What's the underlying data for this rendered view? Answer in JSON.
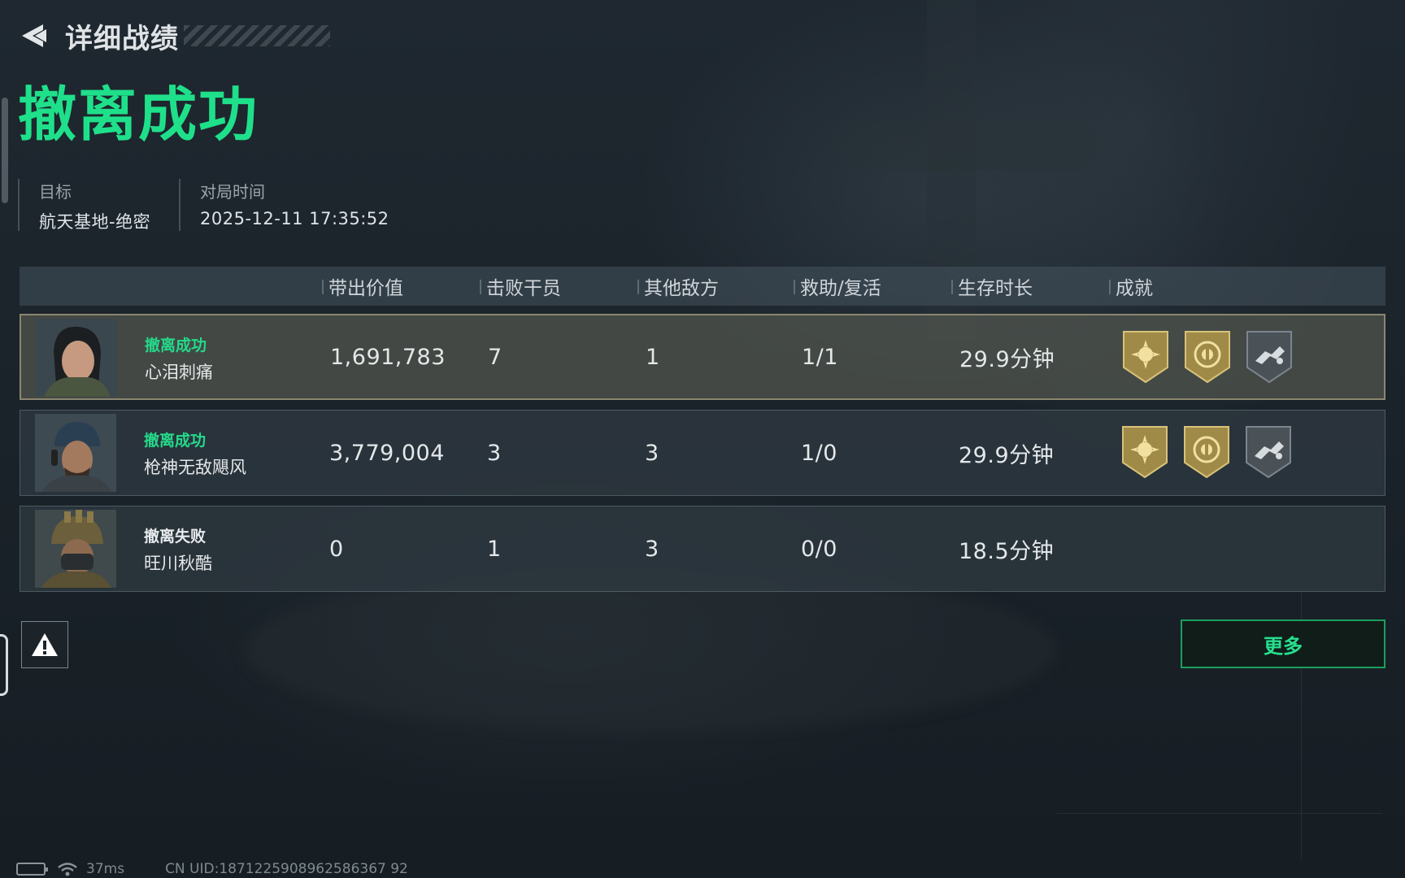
{
  "header": {
    "title": "详细战绩"
  },
  "result": {
    "title": "撤离成功",
    "target_label": "目标",
    "target_value": "航天基地-绝密",
    "time_label": "对局时间",
    "time_value": "2025-12-11 17:35:52"
  },
  "table": {
    "columns": [
      "带出价值",
      "击败干员",
      "其他敌方",
      "救助/复活",
      "生存时长",
      "成就"
    ],
    "rows": [
      {
        "status": "撤离成功",
        "status_type": "success",
        "name": "心泪刺痛",
        "value": "1,691,783",
        "kills": "7",
        "other_enemies": "1",
        "assist_revive": "1/1",
        "survival": "29.9分钟",
        "badges": [
          "sun-badge-icon",
          "emblem-badge-icon",
          "mechanical-arm-badge-icon"
        ]
      },
      {
        "status": "撤离成功",
        "status_type": "success",
        "name": "枪神无敌飓风",
        "value": "3,779,004",
        "kills": "3",
        "other_enemies": "3",
        "assist_revive": "1/0",
        "survival": "29.9分钟",
        "badges": [
          "sun-badge-icon",
          "emblem-badge-icon",
          "mechanical-arm-badge-icon"
        ]
      },
      {
        "status": "撤离失败",
        "status_type": "fail",
        "name": "旺川秋酷",
        "value": "0",
        "kills": "1",
        "other_enemies": "3",
        "assist_revive": "0/0",
        "survival": "18.5分钟",
        "badges": []
      }
    ]
  },
  "actions": {
    "more_label": "更多"
  },
  "statusbar": {
    "ping": "37ms",
    "uid": "CN UID:1871225908962586367 92"
  },
  "colors": {
    "success_green": "#1fe08a",
    "highlight_border": "#8a8670",
    "badge_gold": "#b9a15a"
  }
}
